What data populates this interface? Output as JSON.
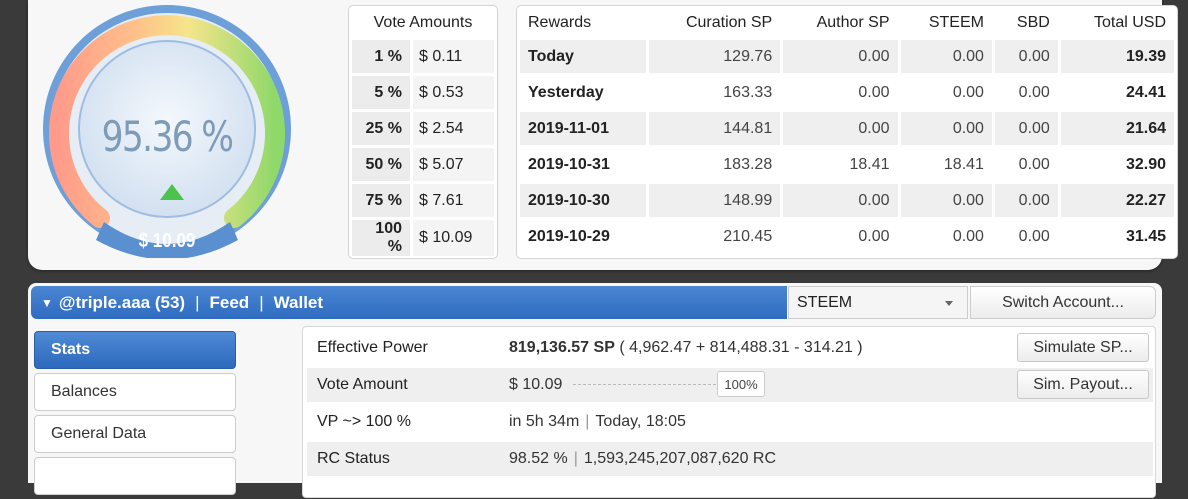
{
  "gauge": {
    "percent_text": "95.36 %",
    "usd_text": "$ 10.09",
    "level": 0.9536,
    "trend_icon": "up-triangle-icon"
  },
  "vote_amounts": {
    "header": "Vote Amounts",
    "rows": [
      {
        "pct": "1 %",
        "usd": "$ 0.11"
      },
      {
        "pct": "5 %",
        "usd": "$ 0.53"
      },
      {
        "pct": "25 %",
        "usd": "$ 2.54"
      },
      {
        "pct": "50 %",
        "usd": "$ 5.07"
      },
      {
        "pct": "75 %",
        "usd": "$ 7.61"
      },
      {
        "pct": "100 %",
        "usd": "$ 10.09"
      }
    ]
  },
  "rewards": {
    "headers": [
      "Rewards",
      "Curation SP",
      "Author SP",
      "STEEM",
      "SBD",
      "Total USD"
    ],
    "rows": [
      [
        "Today",
        "129.76",
        "0.00",
        "0.00",
        "0.00",
        "19.39"
      ],
      [
        "Yesterday",
        "163.33",
        "0.00",
        "0.00",
        "0.00",
        "24.41"
      ],
      [
        "2019-11-01",
        "144.81",
        "0.00",
        "0.00",
        "0.00",
        "21.64"
      ],
      [
        "2019-10-31",
        "183.28",
        "18.41",
        "18.41",
        "0.00",
        "32.90"
      ],
      [
        "2019-10-30",
        "148.99",
        "0.00",
        "0.00",
        "0.00",
        "22.27"
      ],
      [
        "2019-10-29",
        "210.45",
        "0.00",
        "0.00",
        "0.00",
        "31.45"
      ]
    ]
  },
  "nav": {
    "account": "@triple.aaa (53)",
    "sep": "|",
    "feed": "Feed",
    "wallet": "Wallet"
  },
  "currency_select": {
    "value": "STEEM"
  },
  "switch_account": "Switch Account...",
  "menu": [
    "Stats",
    "Balances",
    "General Data"
  ],
  "stats": {
    "effective_power": {
      "label": "Effective Power",
      "value_bold": "819,136.57 SP",
      "value_rest": "( 4,962.47 + 814,488.31 - 314.21 )",
      "button": "Simulate SP..."
    },
    "vote_amount": {
      "label": "Vote Amount",
      "value": "$ 10.09",
      "slider_pct": "100%",
      "slider_level": 1.0,
      "button": "Sim. Payout..."
    },
    "vp": {
      "label": "VP ~> 100 %",
      "value_a": "in 5h 34m",
      "value_b": "Today, 18:05"
    },
    "rc": {
      "label": "RC Status",
      "value_a": "98.52 %",
      "value_b": "1,593,245,207,087,620 RC"
    }
  }
}
